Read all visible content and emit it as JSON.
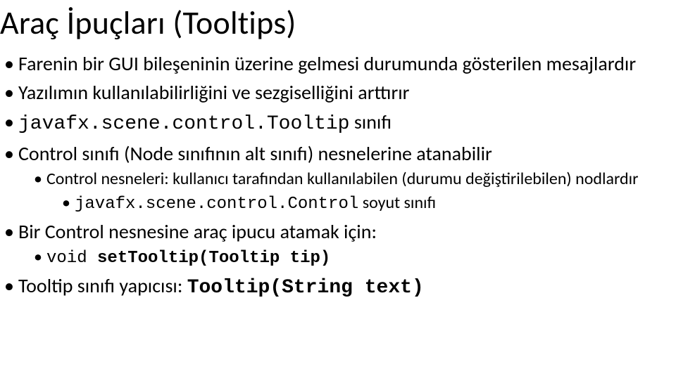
{
  "title": "Araç İpuçları (Tooltips)",
  "b1": "Farenin bir GUI bileşeninin üzerine gelmesi durumunda gösterilen mesajlardır",
  "b2": "Yazılımın kullanılabilirliğini ve sezgiselliğini arttırır",
  "b3_code": "javafx.scene.control.Tooltip",
  "b3_tail": " sınıfı",
  "b4": "Control sınıfı (Node sınıfının alt sınıfı) nesnelerine atanabilir",
  "b4_1": "Control nesneleri: kullanıcı tarafından kullanılabilen (durumu değiştirilebilen) nodlardır",
  "b4_1_1_code": "javafx.scene.control.Control",
  "b4_1_1_tail": " soyut sınıfı",
  "b5": "Bir Control nesnesine araç ipucu atamak için:",
  "b5_1_pre": "void ",
  "b5_1_bold": "setTooltip(Tooltip tip)",
  "b6_text": "Tooltip sınıfı yapıcısı: ",
  "b6_bold": "Tooltip(String text)"
}
